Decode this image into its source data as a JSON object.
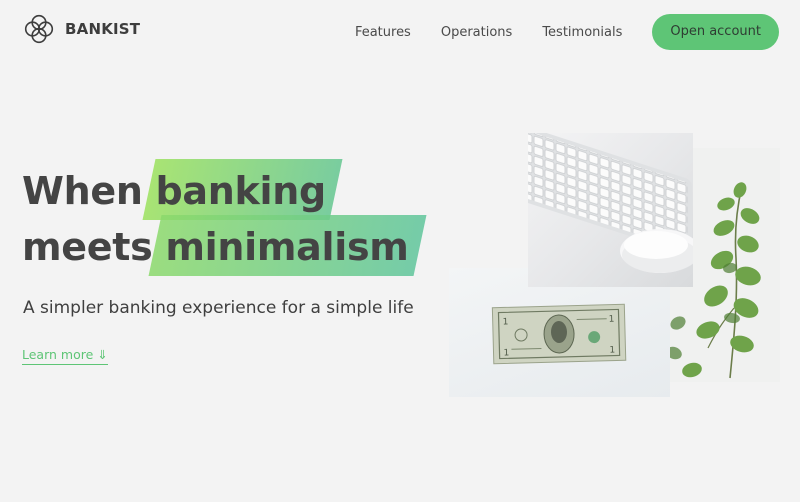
{
  "nav": {
    "brand": "BANKIST",
    "links": [
      {
        "label": "Features"
      },
      {
        "label": "Operations"
      },
      {
        "label": "Testimonials"
      }
    ],
    "cta_label": "Open account"
  },
  "hero": {
    "title_word_1": "When",
    "title_highlight_1": "banking",
    "title_word_2": "meets",
    "title_highlight_2": "minimalism",
    "subtitle": "A simpler banking experience for a simple life",
    "learn_more": "Learn more ⇓",
    "accent_color": "#5ec576",
    "highlight_gradient": [
      "#9be15d",
      "#64c690"
    ]
  },
  "icons": {
    "logo": "bankist-logo-icon"
  }
}
